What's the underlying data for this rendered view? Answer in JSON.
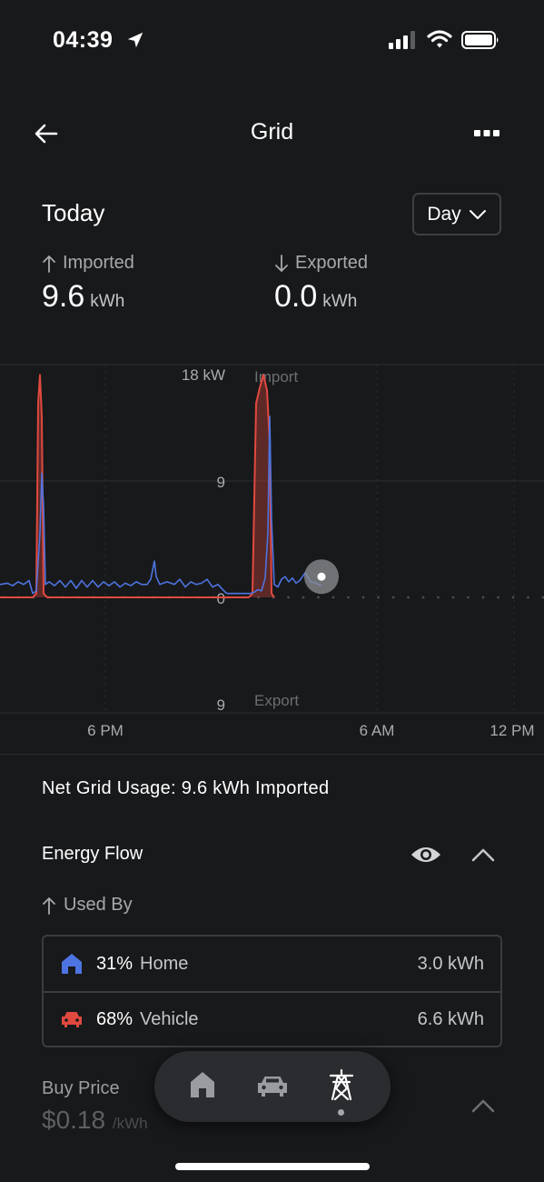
{
  "status_bar": {
    "time": "04:39"
  },
  "header": {
    "title": "Grid"
  },
  "period": {
    "heading": "Today",
    "selector_label": "Day"
  },
  "stats": {
    "imported": {
      "label": "Imported",
      "value": "9.6",
      "unit": "kWh"
    },
    "exported": {
      "label": "Exported",
      "value": "0.0",
      "unit": "kWh"
    }
  },
  "chart_data": {
    "type": "area",
    "y_top_label": "18 kW",
    "y_mid_label": "9",
    "y_zero_label": "0",
    "y_bottom_label": "9",
    "import_label": "Import",
    "export_label": "Export",
    "x_tick_labels": [
      "6 PM",
      "6 AM",
      "12 PM"
    ],
    "ylim": [
      -9,
      18
    ],
    "series": [
      {
        "color": "#e0493f",
        "points": [
          [
            0,
            0
          ],
          [
            36,
            0
          ],
          [
            40,
            0.3
          ],
          [
            42,
            15
          ],
          [
            44,
            17.2
          ],
          [
            46,
            14
          ],
          [
            48,
            0.3
          ],
          [
            52,
            0
          ],
          [
            274,
            0
          ],
          [
            278,
            0.3
          ],
          [
            282,
            15
          ],
          [
            286,
            16.2
          ],
          [
            290,
            17.2
          ],
          [
            294,
            16
          ],
          [
            297,
            12
          ],
          [
            299,
            0.3
          ],
          [
            302,
            0
          ]
        ]
      },
      {
        "color": "#4d74e0",
        "points": [
          [
            0,
            1
          ],
          [
            8,
            1.1
          ],
          [
            14,
            0.9
          ],
          [
            20,
            1.2
          ],
          [
            26,
            1
          ],
          [
            32,
            1.3
          ],
          [
            36,
            0.3
          ],
          [
            40,
            0.5
          ],
          [
            44,
            5
          ],
          [
            46,
            9.6
          ],
          [
            48,
            7
          ],
          [
            50,
            1
          ],
          [
            54,
            1.2
          ],
          [
            60,
            0.9
          ],
          [
            66,
            1.3
          ],
          [
            72,
            0.8
          ],
          [
            78,
            1.3
          ],
          [
            84,
            0.7
          ],
          [
            90,
            1.3
          ],
          [
            96,
            0.8
          ],
          [
            102,
            1.3
          ],
          [
            108,
            0.8
          ],
          [
            114,
            1.2
          ],
          [
            120,
            0.9
          ],
          [
            126,
            1.2
          ],
          [
            132,
            0.8
          ],
          [
            138,
            1.1
          ],
          [
            144,
            0.9
          ],
          [
            150,
            1.2
          ],
          [
            156,
            1
          ],
          [
            162,
            1
          ],
          [
            166,
            1.4
          ],
          [
            170,
            2.8
          ],
          [
            172,
            1.6
          ],
          [
            176,
            1
          ],
          [
            184,
            1.2
          ],
          [
            192,
            1
          ],
          [
            198,
            1.4
          ],
          [
            204,
            0.8
          ],
          [
            210,
            1.2
          ],
          [
            216,
            1
          ],
          [
            222,
            1.1
          ],
          [
            228,
            1.4
          ],
          [
            234,
            0.8
          ],
          [
            240,
            1
          ],
          [
            248,
            0.4
          ],
          [
            250,
            0.3
          ],
          [
            276,
            0.3
          ],
          [
            280,
            0.4
          ],
          [
            284,
            0.6
          ],
          [
            288,
            0.5
          ],
          [
            292,
            1.5
          ],
          [
            295,
            5
          ],
          [
            297,
            14
          ],
          [
            299,
            6
          ],
          [
            302,
            1
          ],
          [
            306,
            0.8
          ],
          [
            310,
            1.4
          ],
          [
            314,
            1.6
          ],
          [
            318,
            1.2
          ],
          [
            322,
            1.5
          ],
          [
            326,
            1.1
          ],
          [
            330,
            1.3
          ],
          [
            336,
            1.9
          ],
          [
            342,
            1.2
          ],
          [
            348,
            1.1
          ],
          [
            354,
            0.9
          ]
        ]
      }
    ],
    "current_marker": {
      "x": 354,
      "y": 1.6
    }
  },
  "summary": {
    "net_grid_usage": "Net Grid Usage: 9.6 kWh Imported"
  },
  "energy_flow": {
    "title": "Energy Flow",
    "used_by_label": "Used By",
    "rows": [
      {
        "icon": "home-icon",
        "percent": "31%",
        "name": "Home",
        "value": "3.0 kWh",
        "color": "#4d74e0"
      },
      {
        "icon": "car-icon",
        "percent": "68%",
        "name": "Vehicle",
        "value": "6.6 kWh",
        "color": "#e0493f"
      }
    ]
  },
  "buy_price": {
    "label": "Buy Price",
    "value": "$0.18",
    "unit": "/kWh"
  },
  "bottom_nav": {
    "items": [
      "home-icon",
      "car-icon",
      "grid-tower-icon"
    ],
    "active": "grid-tower-icon"
  }
}
